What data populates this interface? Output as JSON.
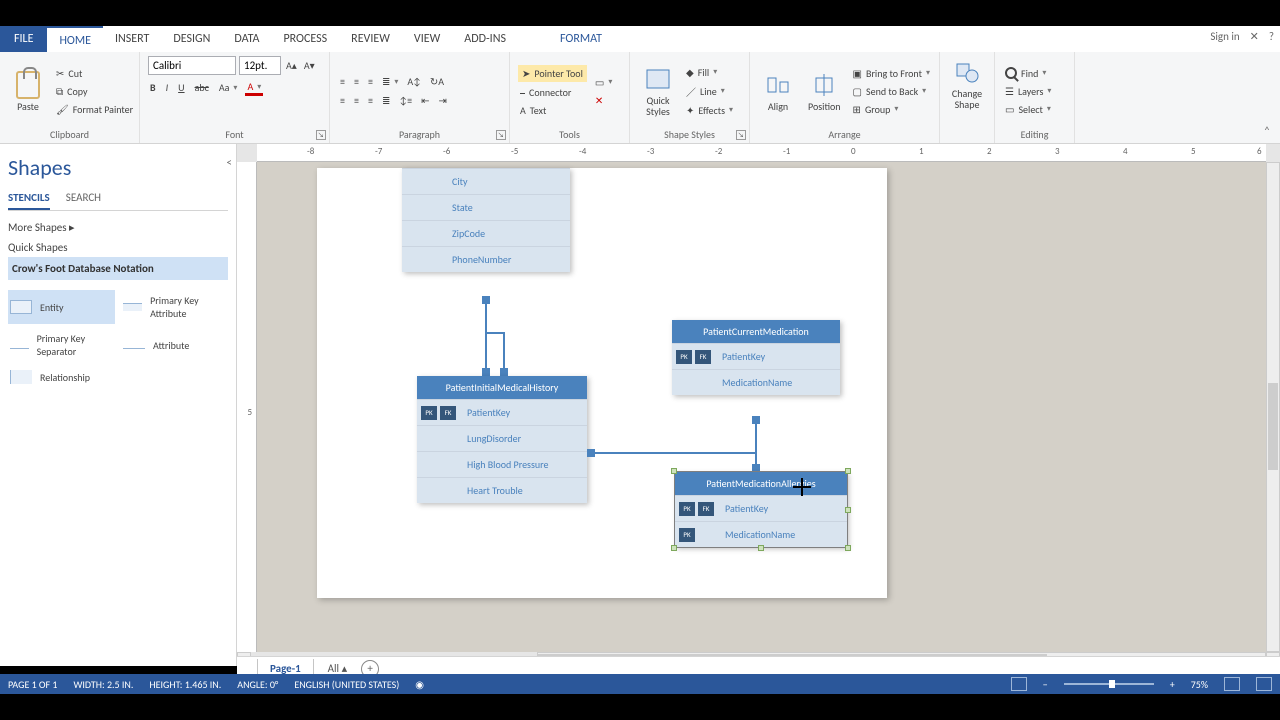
{
  "title_right": {
    "signin": "Sign in",
    "close": "✕",
    "help": "?"
  },
  "tabs": {
    "file": "FILE",
    "items": [
      "HOME",
      "INSERT",
      "DESIGN",
      "DATA",
      "PROCESS",
      "REVIEW",
      "VIEW",
      "ADD-INS"
    ],
    "contextual": "FORMAT",
    "active": "HOME"
  },
  "ribbon": {
    "clipboard": {
      "label": "Clipboard",
      "paste": "Paste",
      "cut": "Cut",
      "copy": "Copy",
      "fmtpainter": "Format Painter"
    },
    "font": {
      "label": "Font",
      "name": "Calibri",
      "size": "12pt."
    },
    "paragraph": {
      "label": "Paragraph"
    },
    "tools": {
      "label": "Tools",
      "pointer": "Pointer Tool",
      "connector": "Connector",
      "text": "Text"
    },
    "shape_styles": {
      "label": "Shape Styles",
      "fill": "Fill",
      "line": "Line",
      "effects": "Effects",
      "quick": "Quick\nStyles"
    },
    "arrange": {
      "label": "Arrange",
      "align": "Align",
      "position": "Position",
      "bringfront": "Bring to Front",
      "sendback": "Send to Back",
      "group": "Group"
    },
    "change_shape": {
      "label": "Change\nShape"
    },
    "editing": {
      "label": "Editing",
      "find": "Find",
      "layers": "Layers",
      "select": "Select"
    }
  },
  "shapes_panel": {
    "title": "Shapes",
    "tab_stencils": "STENCILS",
    "tab_search": "SEARCH",
    "more": "More Shapes",
    "quick": "Quick Shapes",
    "stencil": "Crow's Foot Database Notation",
    "items": [
      "Entity",
      "Primary Key Attribute",
      "Primary Key Separator",
      "Attribute",
      "Relationship"
    ]
  },
  "ruler_ticks": [
    "-8",
    "-7",
    "-6",
    "-5",
    "-4",
    "-3",
    "-2",
    "-1",
    "0",
    "1",
    "2",
    "3",
    "4",
    "5",
    "6"
  ],
  "entities": {
    "topcut": {
      "attrs": [
        "City",
        "State",
        "ZipCode",
        "PhoneNumber"
      ]
    },
    "hist": {
      "title": "PatientInitialMedicalHistory",
      "rows": [
        {
          "keys": [
            "PK",
            "FK"
          ],
          "attr": "PatientKey"
        },
        {
          "keys": [],
          "attr": "LungDisorder"
        },
        {
          "keys": [],
          "attr": "High Blood Pressure"
        },
        {
          "keys": [],
          "attr": "Heart Trouble"
        }
      ]
    },
    "med": {
      "title": "PatientCurrentMedication",
      "rows": [
        {
          "keys": [
            "PK",
            "FK"
          ],
          "attr": "PatientKey"
        },
        {
          "keys": [],
          "attr": "MedicationName"
        }
      ]
    },
    "allergy": {
      "title": "PatientMedicationAllergies",
      "rows": [
        {
          "keys": [
            "PK",
            "FK"
          ],
          "attr": "PatientKey"
        },
        {
          "keys": [
            "PK"
          ],
          "attr": "MedicationName"
        }
      ]
    }
  },
  "page_tabs": {
    "page1": "Page-1",
    "all": "All"
  },
  "status": {
    "page": "PAGE 1 OF 1",
    "width": "WIDTH: 2.5 IN.",
    "height": "HEIGHT: 1.465 IN.",
    "angle": "ANGLE: 0°",
    "lang": "ENGLISH (UNITED STATES)",
    "zoom": "75%"
  }
}
